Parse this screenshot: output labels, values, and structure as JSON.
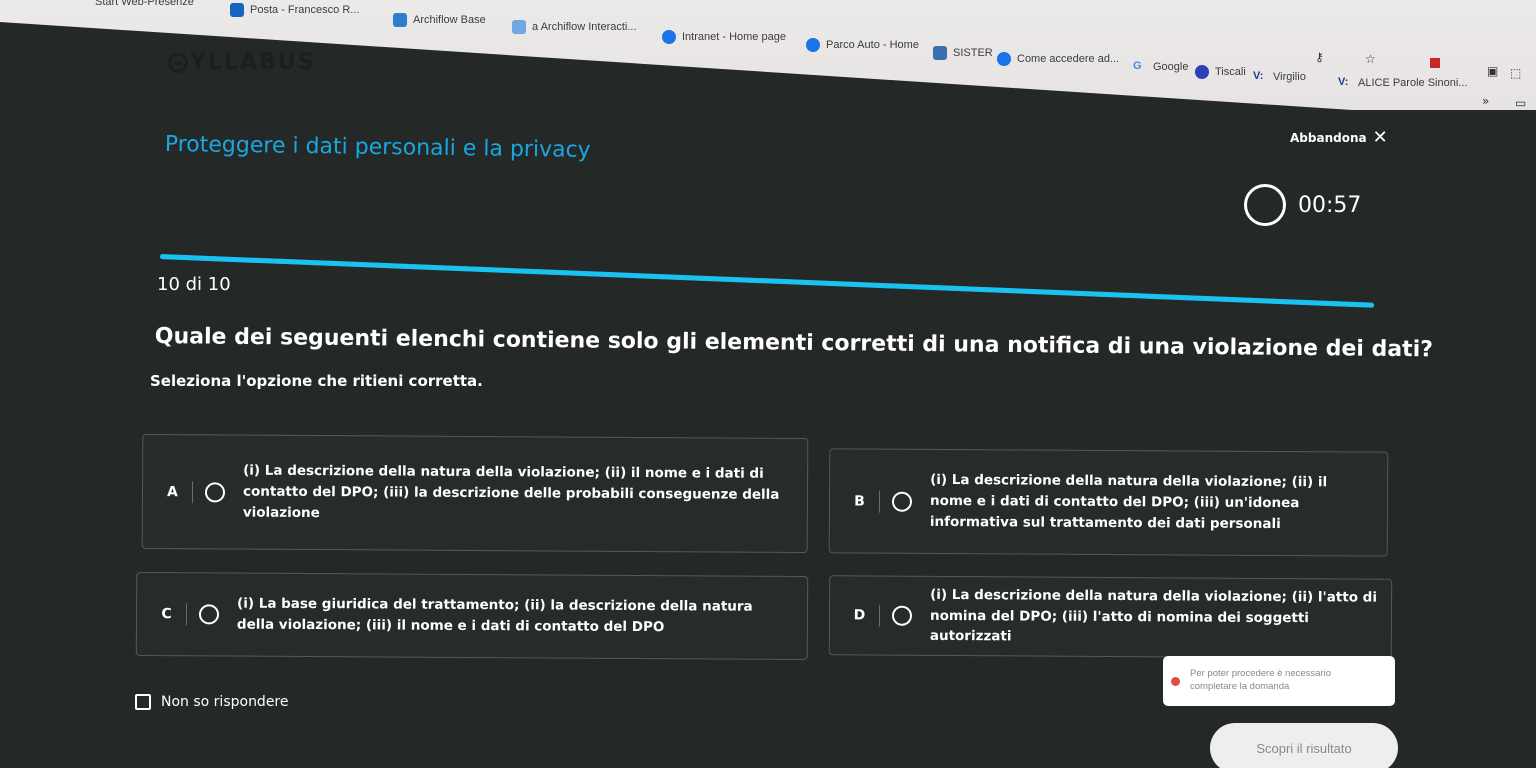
{
  "bookmarks": [
    {
      "label": "Start Web-Presenze",
      "color": "#9a9a9a"
    },
    {
      "label": "Posta - Francesco R...",
      "color": "#1565c0"
    },
    {
      "label": "Archiflow Base",
      "color": "#2e7dd1"
    },
    {
      "label": "a Archiflow Interacti...",
      "color": "#6fa7e0"
    },
    {
      "label": "Intranet - Home page",
      "color": "#1a73e8"
    },
    {
      "label": "Parco Auto - Home",
      "color": "#1a73e8"
    },
    {
      "label": "SISTER",
      "color": "#3a6fb0"
    },
    {
      "label": "Come accedere ad...",
      "color": "#1a73e8"
    },
    {
      "label": "Google",
      "color": "#4285f4"
    },
    {
      "label": "Tiscali",
      "color": "#2a3fb8"
    },
    {
      "label": "Virgilio",
      "color": "#1c3d8a"
    },
    {
      "label": "ALICE Parole Sinoni...",
      "color": "#1c3d8a"
    }
  ],
  "brand": {
    "name": "YLLABUS"
  },
  "header": {
    "exit_label": "Abbandona",
    "course_title": "Proteggere i dati personali e la privacy",
    "timer": "00:57"
  },
  "progress": {
    "current": 10,
    "total": 10,
    "fraction": 1.0,
    "label": "10 di 10"
  },
  "question": {
    "text": "Quale dei seguenti elenchi contiene solo gli elementi corretti di una notifica di una violazione dei dati?",
    "instruction": "Seleziona l'opzione che ritieni corretta."
  },
  "options": [
    {
      "letter": "A",
      "text": "(i) La descrizione della natura della violazione; (ii) il nome e i dati di contatto del DPO; (iii) la descrizione delle probabili conseguenze della violazione"
    },
    {
      "letter": "B",
      "text": "(i) La descrizione della natura della violazione; (ii) il nome e i dati di contatto del DPO; (iii) un'idonea informativa sul trattamento dei dati personali"
    },
    {
      "letter": "C",
      "text": "(i) La base giuridica del trattamento; (ii) la descrizione della natura della violazione; (iii) il nome e i dati di contatto del DPO"
    },
    {
      "letter": "D",
      "text": "(i) La descrizione della natura della violazione; (ii) l'atto di nomina del DPO; (iii) l'atto di nomina dei soggetti autorizzati"
    }
  ],
  "dont_know_label": "Non so rispondere",
  "warning": {
    "line1": "Per poter procedere è necessario",
    "line2": "completare la domanda"
  },
  "submit_label": "Scopri il risultato",
  "colors": {
    "accent": "#19a7e0",
    "background": "#242827",
    "error": "#e24a4a"
  }
}
